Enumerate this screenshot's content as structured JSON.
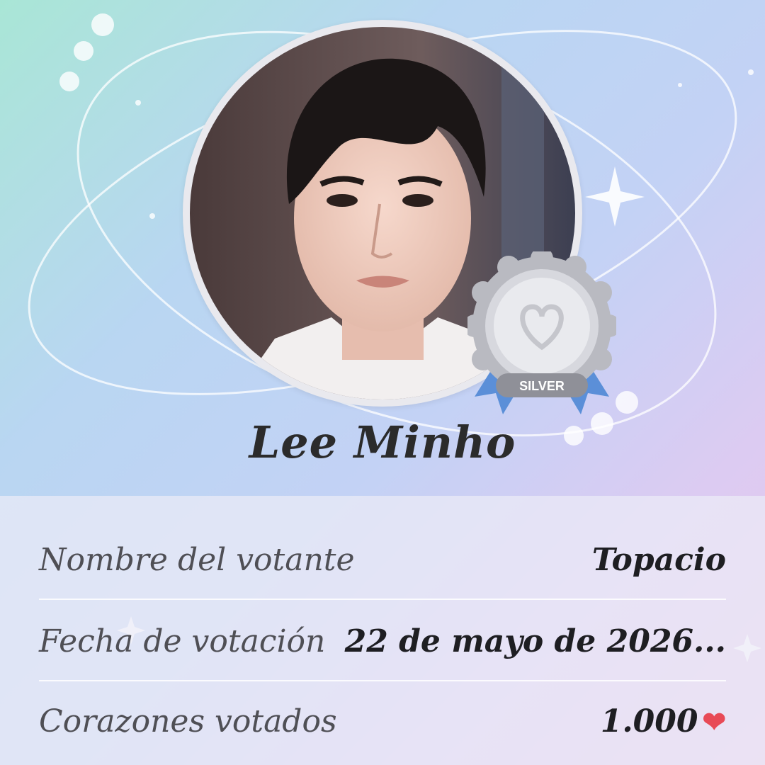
{
  "profile": {
    "name": "Lee Minho",
    "badge_label": "SILVER"
  },
  "details": [
    {
      "label": "Nombre del votante",
      "value": "Topacio"
    },
    {
      "label": "Fecha de votación",
      "value": "22 de mayo de 2026..."
    },
    {
      "label": "Corazones votados",
      "value": "1.000"
    }
  ],
  "icons": {
    "heart": "heart-icon",
    "moon": "moon-icon",
    "sparkle": "sparkle-icon",
    "badge": "silver-medal-icon"
  },
  "colors": {
    "heart": "#e84a56",
    "badge_silver": "#c8c9cf",
    "ribbon": "#5b8fd8"
  }
}
